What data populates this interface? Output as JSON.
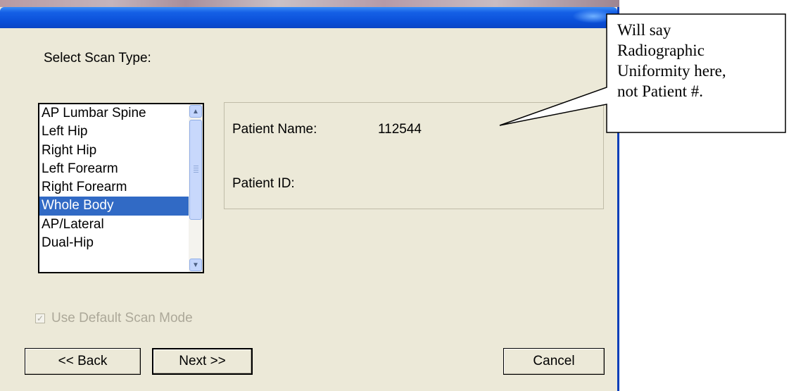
{
  "dialog": {
    "scan_type_label": "Select Scan Type:",
    "scan_types": [
      "AP Lumbar Spine",
      "Left Hip",
      "Right Hip",
      "Left Forearm",
      "Right Forearm",
      "Whole Body",
      "AP/Lateral",
      "Dual-Hip"
    ],
    "selected_scan_type": "Whole Body",
    "patient": {
      "name_label": "Patient Name:",
      "name_value": "112544",
      "id_label": "Patient ID:",
      "id_value": ""
    },
    "default_scan_mode": {
      "label": "Use Default Scan Mode",
      "checked": true,
      "enabled": false
    },
    "buttons": {
      "back": "<< Back",
      "next": "Next >>",
      "cancel": "Cancel"
    }
  },
  "annotation": {
    "text": "Will say\nRadiographic\nUniformity here,\nnot Patient #."
  },
  "colors": {
    "title_bar": "#0a4fd8",
    "dialog_bg": "#ece9d8",
    "selection": "#316ac5",
    "disabled_text": "#aca899"
  }
}
